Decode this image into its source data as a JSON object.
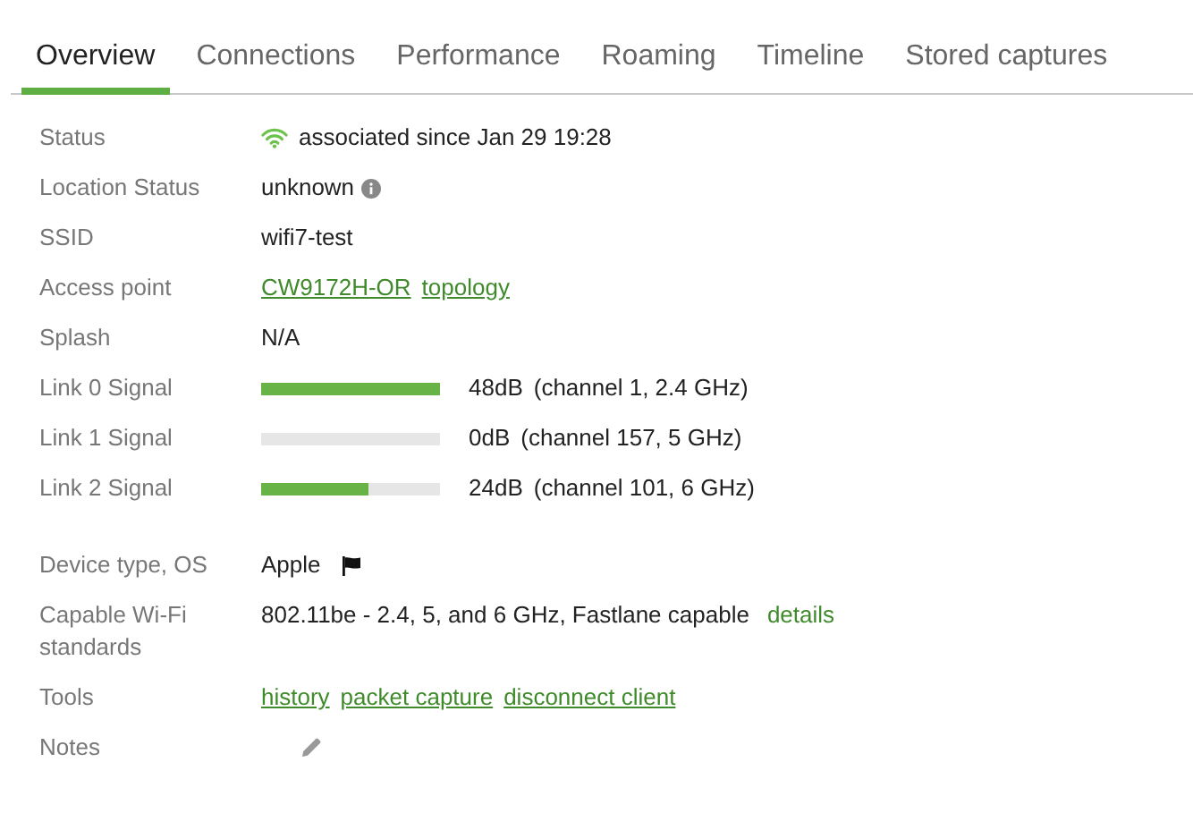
{
  "tabs": [
    {
      "label": "Overview",
      "selected": true
    },
    {
      "label": "Connections",
      "selected": false
    },
    {
      "label": "Performance",
      "selected": false
    },
    {
      "label": "Roaming",
      "selected": false
    },
    {
      "label": "Timeline",
      "selected": false
    },
    {
      "label": "Stored captures",
      "selected": false
    }
  ],
  "rows": [
    {
      "label": "Status",
      "kind": "status",
      "value": "associated since Jan 29 19:28"
    },
    {
      "label": "Location Status",
      "kind": "info",
      "value": "unknown"
    },
    {
      "label": "SSID",
      "kind": "text",
      "value": "wifi7-test"
    },
    {
      "label": "Access point",
      "kind": "links",
      "links": [
        "CW9172H-OR",
        "topology"
      ]
    },
    {
      "label": "Splash",
      "kind": "text",
      "value": "N/A"
    },
    {
      "label": "Link 0 Signal",
      "kind": "signal",
      "level": 1.0,
      "reading": "48dB",
      "detail": "(channel 1, 2.4 GHz)"
    },
    {
      "label": "Link 1 Signal",
      "kind": "signal",
      "level": 0,
      "reading": "0dB",
      "detail": "(channel 157, 5 GHz)"
    },
    {
      "label": "Link 2 Signal",
      "kind": "signal",
      "level": 0.6,
      "reading": "24dB",
      "detail": "(channel 101, 6 GHz)"
    },
    {
      "label": "Device type, OS",
      "kind": "device",
      "value": "Apple"
    },
    {
      "label": "Capable Wi-Fi standards",
      "kind": "capable",
      "value": "802.11be - 2.4, 5, and 6 GHz, Fastlane capable",
      "link": "details"
    },
    {
      "label": "Tools",
      "kind": "links",
      "links": [
        "history",
        "packet capture",
        "disconnect client"
      ]
    },
    {
      "label": "Notes",
      "kind": "notes"
    }
  ]
}
